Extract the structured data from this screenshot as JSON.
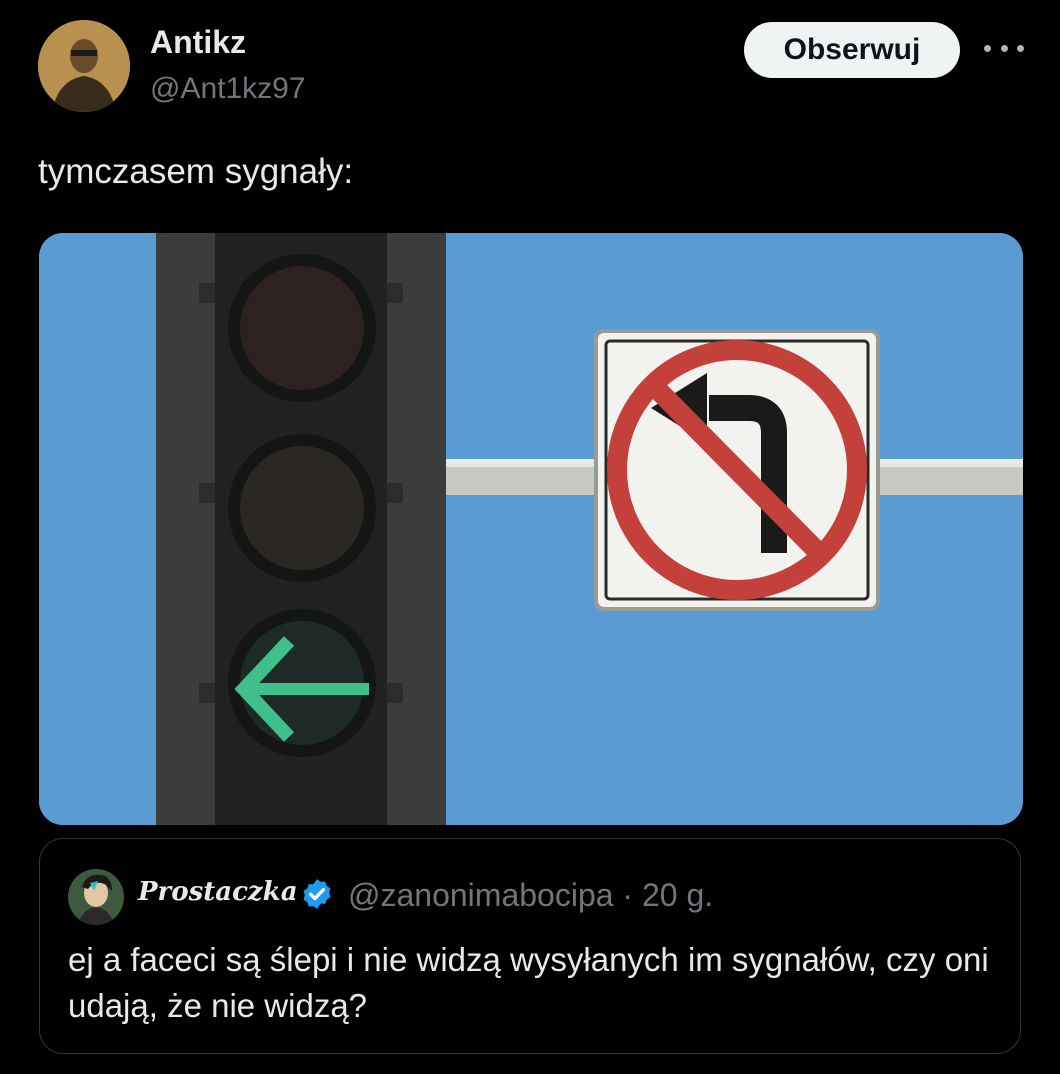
{
  "author": {
    "display_name": "Antikz",
    "handle": "@Ant1kz97",
    "avatar_icon": "profile-photo"
  },
  "follow_button": {
    "label": "Obserwuj"
  },
  "more_icon": "ellipsis-icon",
  "tweet": {
    "text": "tymczasem sygnały:"
  },
  "media": {
    "description_icons": [
      "traffic-light-icon",
      "no-left-turn-sign-icon"
    ],
    "colors": {
      "sky": "#5b9bd4",
      "green_arrow": "#3fbf8a",
      "sign_red": "#c4403a"
    }
  },
  "quote": {
    "display_name": "Prostaczka",
    "handle": "@zanonimabocipa",
    "separator": "·",
    "time": "20 g.",
    "verified_color": "#1d9bf0",
    "text": "ej a faceci są ślepi i nie widzą wysyłanych im sygnałów, czy oni udają, że nie widzą?"
  }
}
